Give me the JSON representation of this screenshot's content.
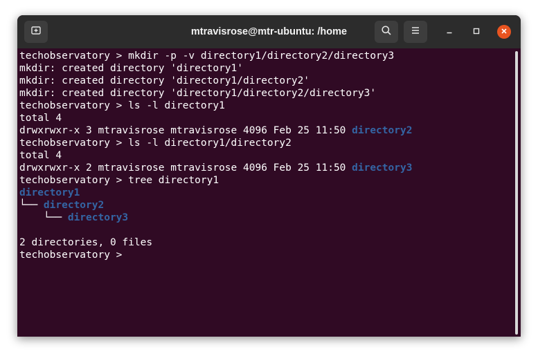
{
  "window": {
    "title": "mtravisrose@mtr-ubuntu: /home"
  },
  "icons": {
    "new_tab": "new-tab-icon",
    "search": "search-icon",
    "menu": "hamburger-menu-icon",
    "minimize": "minimize-icon",
    "maximize": "maximize-icon",
    "close": "close-icon"
  },
  "colors": {
    "terminal_bg": "#300a24",
    "titlebar_bg": "#2c2c2c",
    "directory_text": "#3465a4",
    "close_button": "#e95420"
  },
  "terminal": {
    "lines": [
      {
        "text": "techobservatory > mkdir -p -v directory1/directory2/directory3"
      },
      {
        "text": "mkdir: created directory 'directory1'"
      },
      {
        "text": "mkdir: created directory 'directory1/directory2'"
      },
      {
        "text": "mkdir: created directory 'directory1/directory2/directory3'"
      },
      {
        "text": "techobservatory > ls -l directory1"
      },
      {
        "text": "total 4"
      },
      {
        "text": "drwxrwxr-x 3 mtravisrose mtravisrose 4096 Feb 25 11:50 ",
        "dir": "directory2"
      },
      {
        "text": "techobservatory > ls -l directory1/directory2"
      },
      {
        "text": "total 4"
      },
      {
        "text": "drwxrwxr-x 2 mtravisrose mtravisrose 4096 Feb 25 11:50 ",
        "dir": "directory3"
      },
      {
        "text": "techobservatory > tree directory1"
      },
      {
        "text": "",
        "dir": "directory1"
      },
      {
        "text": "└── ",
        "dir": "directory2"
      },
      {
        "text": "    └── ",
        "dir": "directory3"
      },
      {
        "text": ""
      },
      {
        "text": "2 directories, 0 files"
      },
      {
        "text": "techobservatory > "
      }
    ]
  }
}
